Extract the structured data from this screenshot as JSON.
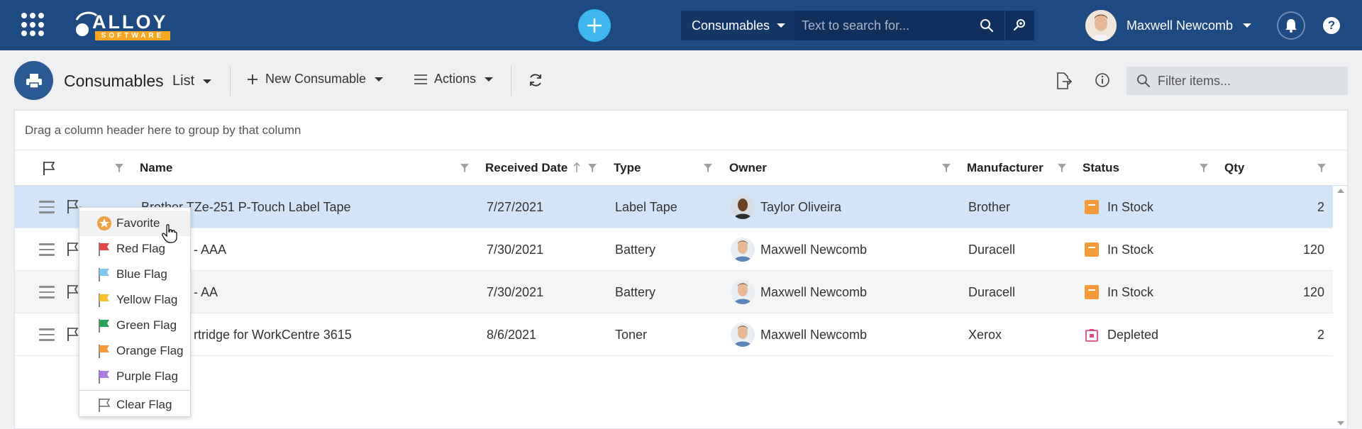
{
  "header": {
    "logo_text": "ALLOY",
    "logo_sub": "SOFTWARE",
    "search_scope": "Consumables",
    "search_placeholder": "Text to search for...",
    "user_name": "Maxwell Newcomb",
    "help_label": "?"
  },
  "toolbar": {
    "title": "Consumables",
    "view": "List",
    "new_label": "New Consumable",
    "actions_label": "Actions",
    "filter_placeholder": "Filter items..."
  },
  "grid": {
    "group_hint": "Drag a column header here to group by that column",
    "columns": {
      "name": "Name",
      "received_date": "Received Date",
      "type": "Type",
      "owner": "Owner",
      "manufacturer": "Manufacturer",
      "status": "Status",
      "qty": "Qty"
    },
    "rows": [
      {
        "name": "Brother TZe-251 P-Touch Label Tape",
        "received_date": "7/27/2021",
        "type": "Label Tape",
        "owner": "Taylor Oliveira",
        "manufacturer": "Brother",
        "status": "In Stock",
        "qty": "2"
      },
      {
        "name": "- AAA",
        "received_date": "7/30/2021",
        "type": "Battery",
        "owner": "Maxwell Newcomb",
        "manufacturer": "Duracell",
        "status": "In Stock",
        "qty": "120"
      },
      {
        "name": "- AA",
        "received_date": "7/30/2021",
        "type": "Battery",
        "owner": "Maxwell Newcomb",
        "manufacturer": "Duracell",
        "status": "In Stock",
        "qty": "120"
      },
      {
        "name": "rtridge for WorkCentre 3615",
        "received_date": "8/6/2021",
        "type": "Toner",
        "owner": "Maxwell Newcomb",
        "manufacturer": "Xerox",
        "status": "Depleted",
        "qty": "2"
      }
    ]
  },
  "flag_menu": {
    "items": [
      {
        "label": "Favorite",
        "icon": "star-icon",
        "color": "#f0a040"
      },
      {
        "label": "Red Flag",
        "icon": "flag-icon",
        "color": "#e04848"
      },
      {
        "label": "Blue Flag",
        "icon": "flag-icon",
        "color": "#7ec8f0"
      },
      {
        "label": "Yellow Flag",
        "icon": "flag-icon",
        "color": "#f5c330"
      },
      {
        "label": "Green Flag",
        "icon": "flag-icon",
        "color": "#2aa05a"
      },
      {
        "label": "Orange Flag",
        "icon": "flag-icon",
        "color": "#f39a3a"
      },
      {
        "label": "Purple Flag",
        "icon": "flag-icon",
        "color": "#a87ee0"
      },
      {
        "label": "Clear Flag",
        "icon": "flag-outline-icon",
        "color": "#666666"
      }
    ]
  },
  "colors": {
    "header_bg": "#1e4a82",
    "accent": "#3fb6ee",
    "selected_row": "#d3e4f8",
    "in_stock": "#f39a3a",
    "depleted": "#d94a7a"
  }
}
